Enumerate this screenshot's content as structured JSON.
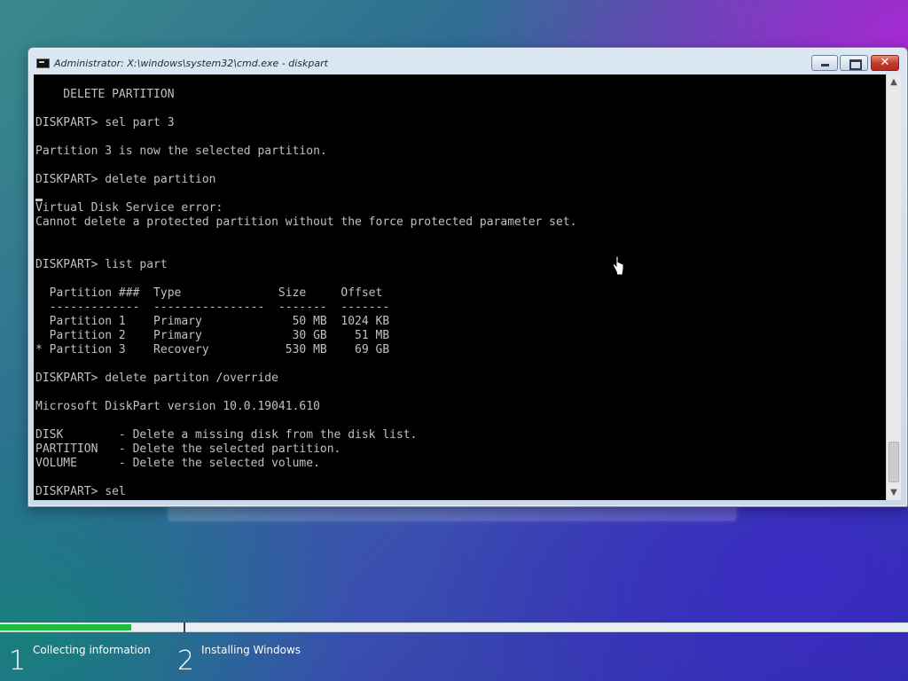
{
  "window": {
    "title": "Administrator: X:\\windows\\system32\\cmd.exe - diskpart",
    "controls": {
      "minimize": "minimize",
      "maximize": "maximize",
      "close": "✕"
    }
  },
  "console": {
    "lines": [
      "    DELETE PARTITION",
      "",
      "DISKPART> sel part 3",
      "",
      "Partition 3 is now the selected partition.",
      "",
      "DISKPART> delete partition",
      "",
      "Virtual Disk Service error:",
      "Cannot delete a protected partition without the force protected parameter set.",
      "",
      "",
      "DISKPART> list part",
      "",
      "  Partition ###  Type              Size     Offset",
      "  -------------  ----------------  -------  -------",
      "  Partition 1    Primary             50 MB  1024 KB",
      "  Partition 2    Primary             30 GB    51 MB",
      "* Partition 3    Recovery           530 MB    69 GB",
      "",
      "DISKPART> delete partiton /override",
      "",
      "Microsoft DiskPart version 10.0.19041.610",
      "",
      "DISK        - Delete a missing disk from the disk list.",
      "PARTITION   - Delete the selected partition.",
      "VOLUME      - Delete the selected volume.",
      "",
      "DISKPART> sel"
    ]
  },
  "setup": {
    "progress_fraction": 0.145,
    "steps": [
      {
        "number": "1",
        "label": "Collecting information"
      },
      {
        "number": "2",
        "label": "Installing Windows"
      }
    ]
  },
  "colors": {
    "progress": "#1ebc3c",
    "console_bg": "#000000",
    "console_fg": "#c0c0c0"
  }
}
